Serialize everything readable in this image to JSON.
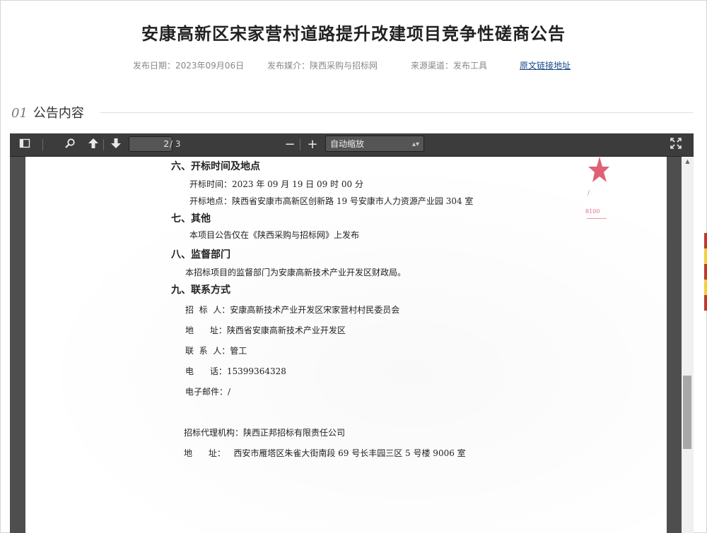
{
  "announcement": {
    "title": "安康高新区宋家营村道路提升改建项目竞争性磋商公告",
    "publish_date": "发布日期：2023年09月06日",
    "publish_media": "发布媒介：陕西采购与招标网",
    "source_channel": "来源渠道：发布工具",
    "original_link": "原文链接地址"
  },
  "section": {
    "number": "01",
    "title": "公告内容"
  },
  "viewer": {
    "current_page": "2",
    "total_pages": "/ 3",
    "zoom": "自动缩放"
  },
  "document": {
    "s6_heading": "六、开标时间及地点",
    "s6_time": "开标时间：2023 年 09 月 19 日  09 时 00 分",
    "s6_place": "开标地点：陕西省安康市高新区创新路 19 号安康市人力资源产业园 304 室",
    "s7_heading": "七、其他",
    "s7_text": "本项目公告仅在《陕西采购与招标网》上发布",
    "s8_heading": "八、监督部门",
    "s8_text": "本招标项目的监督部门为安康高新技术产业开发区财政局。",
    "s9_heading": "九、联系方式",
    "tenderer": "招  标  人：安康高新技术产业开发区宋家营村村民委员会",
    "address": "地      址：陕西省安康高新技术产业开发区",
    "contact": "联  系  人：管工",
    "phone": "电      话：15399364328",
    "email": "电子邮件：/",
    "agency": "招标代理机构：陕西正邦招标有限责任公司",
    "agency_address": "地      址：   西安市雁塔区朱雀大街南段 69 号长丰园三区 5 号楼 9006 室",
    "stamp_text": "8100"
  },
  "colors": {
    "stamp": "#d9455f",
    "link": "#1a4a8a"
  }
}
